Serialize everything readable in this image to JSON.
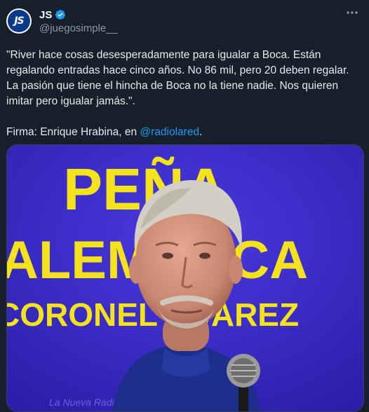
{
  "tweet": {
    "author_name": "JS",
    "handle": "@juegosimple__",
    "avatar_text": "JS",
    "verified_icon": "verified-badge-icon",
    "more_icon": "more-options-icon",
    "text_p1": "\"River hace cosas desesperadamente para igualar a Boca. Están regalando entradas hace cinco años. No 86 mil, pero 20 deben regalar. La pasión que tiene el hincha de Boca no la tiene nadie. Nos quieren imitar pero igualar jamás.\".",
    "text_p2_prefix": "Firma: Enrique Hrabina, en ",
    "mention": "@radiolared",
    "text_p2_suffix": "."
  },
  "media": {
    "banner_line1": "PEÑA",
    "banner_line2": "ALEMBOCA",
    "banner_line3": "CORONEL SUAREZ",
    "banner_bottom": "La Nueva Radio Pasión",
    "colors": {
      "banner_bg": "#3b2bd0",
      "banner_text": "#f4e21a",
      "accent": "#1d9bf0"
    }
  }
}
